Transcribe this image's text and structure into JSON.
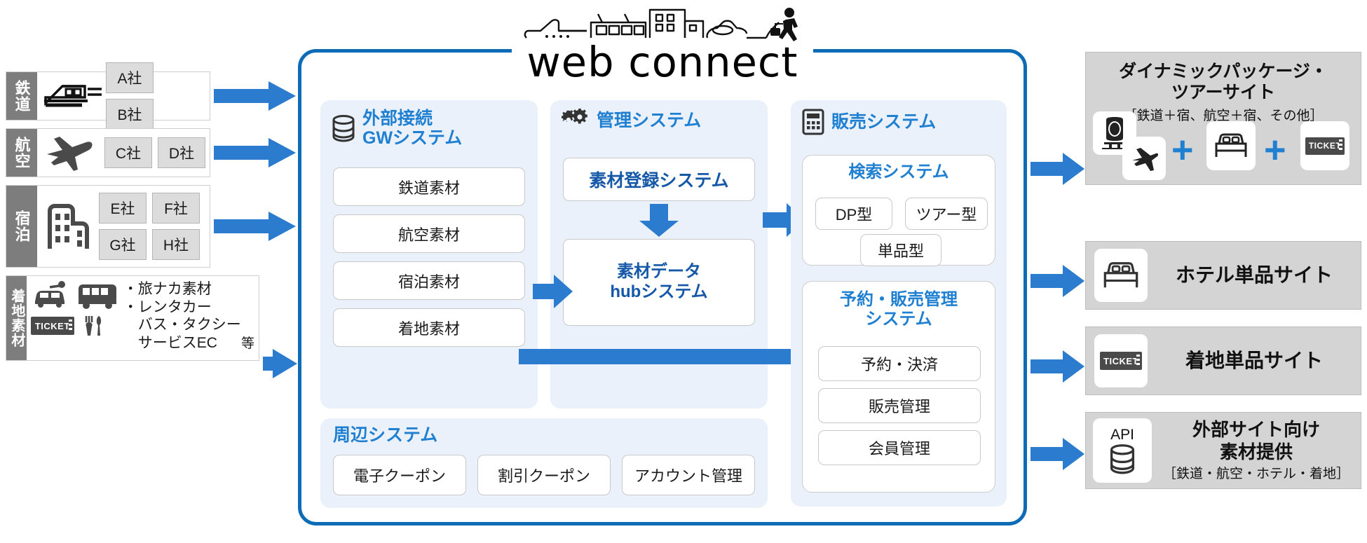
{
  "sources": [
    {
      "tab": "鉄道",
      "icon": "bullet-train-icon",
      "companies": [
        "A社",
        "B社"
      ]
    },
    {
      "tab": "航空",
      "icon": "airplane-icon",
      "companies": [
        "C社",
        "D社"
      ]
    },
    {
      "tab": "宿泊",
      "icon": "building-icon",
      "companies": [
        "E社",
        "F社",
        "G社",
        "H社"
      ]
    },
    {
      "tab": "着地素材",
      "icon": "taxi-bus-ticket-cutlery-icon",
      "list": [
        "・旅ナカ素材",
        "・レンタカー",
        "　バス・タクシー",
        "　サービスEC"
      ],
      "etc": "等"
    }
  ],
  "brand": {
    "logo_text": "web connect",
    "logo_icon": "city-skyline-icon"
  },
  "gateway_panel": {
    "icon": "database-icon",
    "title_line1": "外部接続",
    "title_line2": "GWシステム",
    "items": [
      "鉄道素材",
      "航空素材",
      "宿泊素材",
      "着地素材"
    ]
  },
  "management_panel": {
    "icon": "gears-icon",
    "title": "管理システム",
    "register_label": "素材登録システム",
    "hub_label_line1": "素材データ",
    "hub_label_line2": "hubシステム"
  },
  "sales_panel": {
    "icon": "calculator-icon",
    "title": "販売システム",
    "search_system": {
      "title": "検索システム",
      "items": [
        "DP型",
        "ツアー型",
        "単品型"
      ]
    },
    "reservation_system": {
      "title_line1": "予約・販売管理",
      "title_line2": "システム",
      "items": [
        "予約・決済",
        "販売管理",
        "会員管理"
      ]
    }
  },
  "peripheral_panel": {
    "title": "周辺システム",
    "items": [
      "電子クーポン",
      "割引クーポン",
      "アカウント管理"
    ]
  },
  "outputs": [
    {
      "title_line1": "ダイナミックパッケージ・",
      "title_line2": "ツアーサイト",
      "subtitle": "［鉄道＋宿、航空＋宿、その他］",
      "icons": [
        "train-icon",
        "airplane-icon",
        "bed-icon",
        "ticket-icon"
      ],
      "plus": "＋"
    },
    {
      "title_line1": "ホテル単品サイト",
      "icons": [
        "bed-icon"
      ]
    },
    {
      "title_line1": "着地単品サイト",
      "icons": [
        "ticket-icon"
      ]
    },
    {
      "title_line1": "外部サイト向け",
      "title_line2": "素材提供",
      "subtitle": "［鉄道・航空・ホテル・着地］",
      "icons": [
        "api-database-icon"
      ],
      "api_label": "API"
    }
  ],
  "colors": {
    "brand_blue": "#0d6cb5",
    "arrow_blue": "#2b7bce",
    "panel_bg": "#eaf1fa",
    "title_blue": "#1f7fd1",
    "tab_gray": "#7d7d7d",
    "card_gray": "#d4d4d4",
    "chip_gray": "#dcdcdc"
  }
}
